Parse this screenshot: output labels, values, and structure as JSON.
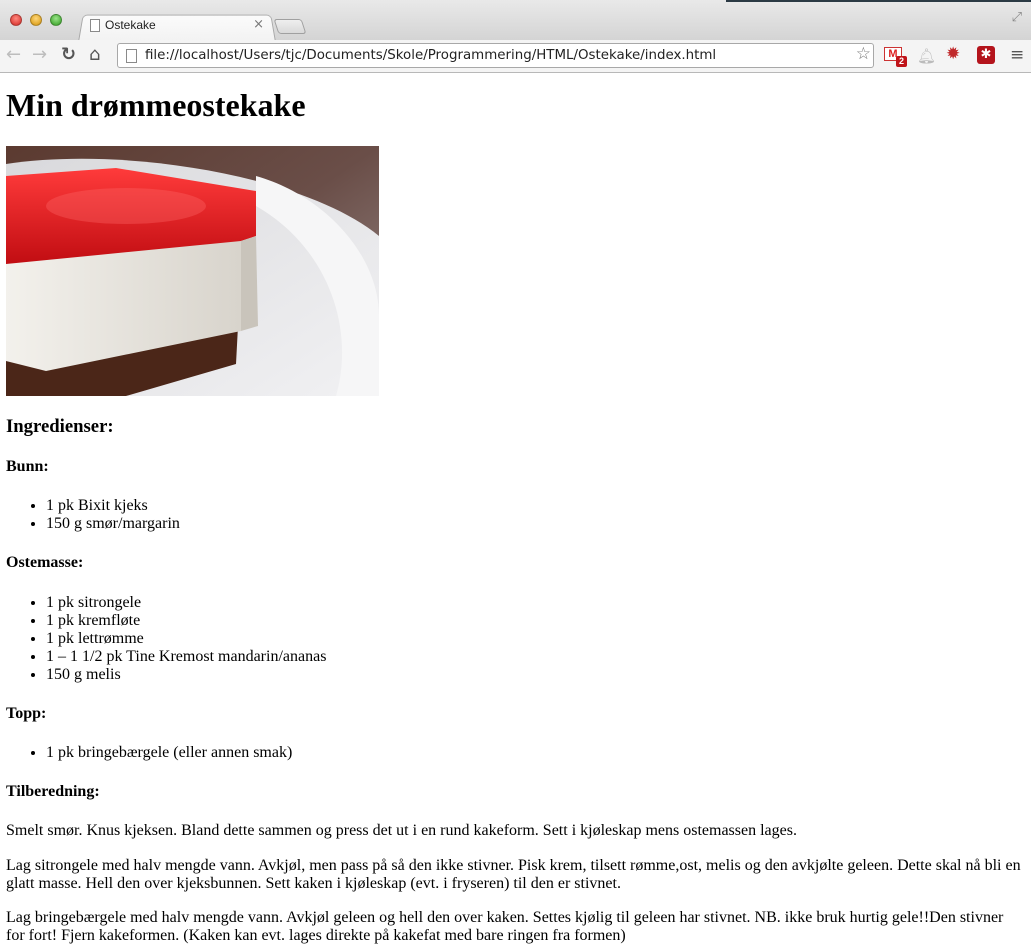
{
  "browser": {
    "tab_title": "Ostekake",
    "tab_close": "×",
    "url": "file://localhost/Users/tjc/Documents/Skole/Programmering/HTML/Ostekake/index.html",
    "gmail_badge": "2",
    "icons": [
      "back-icon",
      "forward-icon",
      "reload-icon",
      "home-icon",
      "page-icon",
      "star-icon",
      "gmail-icon",
      "bell-icon",
      "gear-icon",
      "lastpass-icon",
      "menu-icon"
    ]
  },
  "page": {
    "title": "Min drømmeostekake",
    "ingredients_heading": "Ingredienser:",
    "bunn_heading": "Bunn:",
    "bunn_items": [
      "1 pk Bixit kjeks",
      "150 g smør/margarin"
    ],
    "ostemasse_heading": "Ostemasse:",
    "ostemasse_items": [
      "1 pk sitrongele",
      "1 pk kremfløte",
      "1 pk lettrømme",
      "1 – 1 1/2 pk Tine Kremost mandarin/ananas",
      "150 g melis"
    ],
    "topp_heading": "Topp:",
    "topp_items": [
      "1 pk bringebærgele (eller annen smak)"
    ],
    "tilberedning_heading": "Tilberedning:",
    "steps": [
      "Smelt smør. Knus kjeksen. Bland dette sammen og press det ut i en rund kakeform. Sett i kjøleskap mens ostemassen lages.",
      "Lag sitrongele med halv mengde vann. Avkjøl, men pass på så den ikke stivner. Pisk krem, tilsett rømme,ost, melis og den avkjølte geleen. Dette skal nå bli en glatt masse. Hell den over kjeksbunnen. Sett kaken i kjøleskap (evt. i fryseren) til den er stivnet.",
      "Lag bringebærgele med halv mengde vann. Avkjøl geleen og hell den over kaken. Settes kjølig til geleen har stivnet. NB. ikke bruk hurtig gele!!Den stivner for fort! Fjern kakeformen. (Kaken kan evt. lages direkte på kakefat med bare ringen fra formen)"
    ]
  }
}
